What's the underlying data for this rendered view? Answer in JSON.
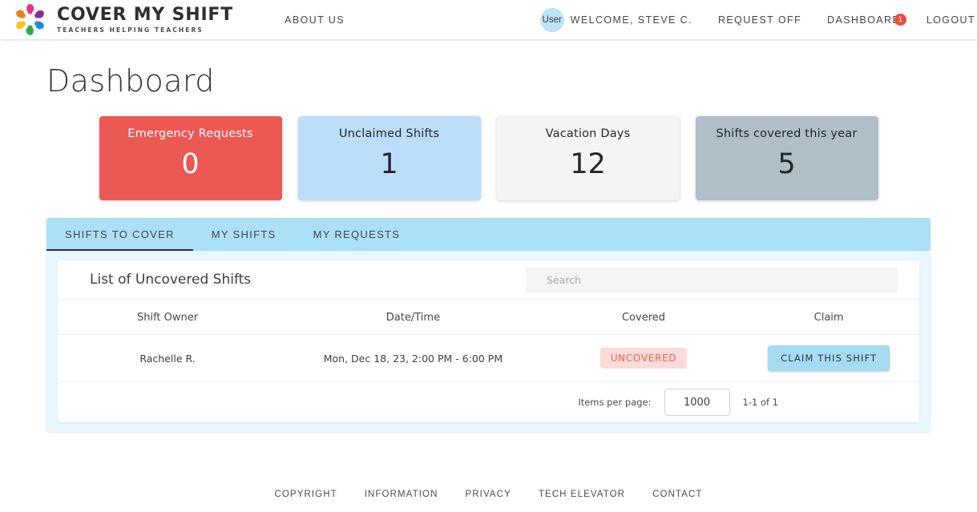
{
  "header": {
    "brand_title": "COVER MY SHIFT",
    "brand_subtitle": "TEACHERS HELPING TEACHERS",
    "logo_icon": "hands-circle-logo-icon",
    "nav_about": "ABOUT US",
    "avatar_label": "User",
    "welcome": "WELCOME, STEVE C.",
    "request_off": "REQUEST OFF",
    "dashboard": "DASHBOARD",
    "dashboard_badge": "1",
    "logout": "LOGOUT"
  },
  "page": {
    "title": "Dashboard"
  },
  "stats": [
    {
      "label": "Emergency Requests",
      "value": "0",
      "style": "card-red",
      "name": "stat-card-emergency-requests"
    },
    {
      "label": "Unclaimed Shifts",
      "value": "1",
      "style": "card-blue",
      "name": "stat-card-unclaimed-shifts"
    },
    {
      "label": "Vacation Days",
      "value": "12",
      "style": "card-gray-light",
      "name": "stat-card-vacation-days"
    },
    {
      "label": "Shifts covered this year",
      "value": "5",
      "style": "card-gray",
      "name": "stat-card-shifts-covered"
    }
  ],
  "tabs": [
    {
      "label": "SHIFTS TO COVER",
      "active": true
    },
    {
      "label": "MY SHIFTS",
      "active": false
    },
    {
      "label": "MY REQUESTS",
      "active": false
    }
  ],
  "table_card": {
    "title": "List of Uncovered Shifts",
    "search_placeholder": "Search",
    "search_value": "",
    "columns": [
      "Shift Owner",
      "Date/Time",
      "Covered",
      "Claim"
    ],
    "rows": [
      {
        "owner": "Rachelle R.",
        "datetime": "Mon, Dec 18, 23, 2:00 PM - 6:00 PM",
        "covered_status": "UNCOVERED",
        "claim_label": "CLAIM THIS SHIFT"
      }
    ]
  },
  "paginator": {
    "items_per_page_label": "Items per page:",
    "items_per_page_value": "1000",
    "range_label": "1-1 of 1"
  },
  "footer": {
    "links": [
      "COPYRIGHT",
      "INFORMATION",
      "PRIVACY",
      "TECH ELEVATOR",
      "CONTACT"
    ]
  },
  "colors": {
    "accent_red": "#ec5853",
    "accent_blue": "#bcdefa",
    "tabbar_blue": "#ace0f7",
    "panel_blue": "#e8f6fd",
    "card_gray": "#b0bec8",
    "badge_red": "#e94f3e",
    "uncovered_bg": "#fbdcd8",
    "uncovered_text": "#e8655c"
  }
}
